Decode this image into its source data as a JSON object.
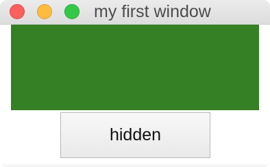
{
  "window": {
    "title": "my first window",
    "traffic_lights": {
      "close": {
        "icon": "close-icon",
        "color": "#fc605c"
      },
      "minimize": {
        "icon": "minimize-icon",
        "color": "#fdbc40"
      },
      "zoom": {
        "icon": "zoom-icon",
        "color": "#34c84a"
      }
    }
  },
  "content": {
    "canvas_color": "#357f24",
    "button_label": "hidden"
  }
}
